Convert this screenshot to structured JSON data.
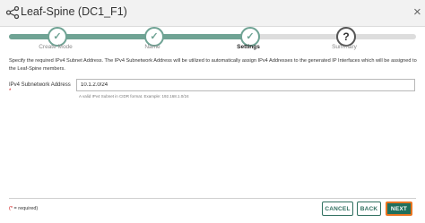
{
  "window": {
    "title": "Leaf-Spine (DC1_F1)",
    "title_icon": "topology-icon",
    "close_label": "×"
  },
  "wizard": {
    "steps": [
      {
        "label": "Create Mode",
        "state": "complete",
        "icon": "check-icon",
        "glyph": "✓"
      },
      {
        "label": "Name",
        "state": "complete",
        "icon": "check-icon",
        "glyph": "✓"
      },
      {
        "label": "Settings",
        "state": "active",
        "icon": "check-icon",
        "glyph": "✓"
      },
      {
        "label": "Summary",
        "state": "pending",
        "icon": "question-icon",
        "glyph": "?"
      }
    ],
    "progress_fraction": 0.6,
    "accent_color": "#6fa394"
  },
  "form": {
    "instructions": "Specify the required IPv4 Subnet Address. The IPv4 Subnetwork Address will be utilized to automatically assign IPv4 Addresses to the generated IP Interfaces which will be assigned to the Leaf-Spine members.",
    "subnet_label": "IPv4 Subnetwork Address",
    "required_marker": "*",
    "subnet_value": "10.1.2.0/24",
    "subnet_hint": "A valid IPv4 Subnet in CIDR format. Example: 192.168.1.0/24"
  },
  "footer": {
    "required_note_star": "(*",
    "required_note_text": " = required)",
    "cancel_label": "CANCEL",
    "back_label": "BACK",
    "next_label": "NEXT",
    "primary_color": "#1f6f5c",
    "focus_color": "#e8731f"
  }
}
